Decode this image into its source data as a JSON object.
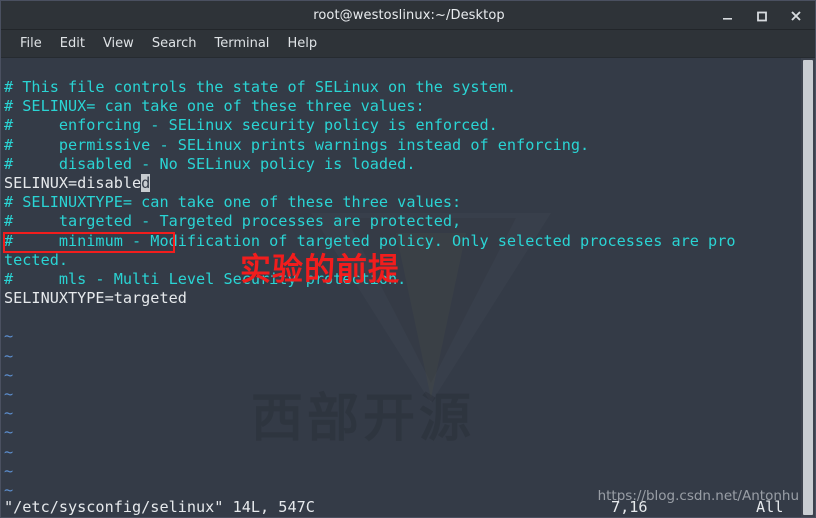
{
  "window": {
    "title": "root@westoslinux:~/Desktop",
    "controls": [
      {
        "name": "minimize",
        "glyph": "minimize-icon"
      },
      {
        "name": "maximize",
        "glyph": "maximize-icon"
      },
      {
        "name": "close",
        "glyph": "close-icon"
      }
    ]
  },
  "menubar": {
    "items": [
      "File",
      "Edit",
      "View",
      "Search",
      "Terminal",
      "Help"
    ]
  },
  "editor": {
    "lines": [
      {
        "text": "# This file controls the state of SELinux on the system.",
        "style": "comment"
      },
      {
        "text": "# SELINUX= can take one of these three values:",
        "style": "comment"
      },
      {
        "text": "#     enforcing - SELinux security policy is enforced.",
        "style": "comment"
      },
      {
        "text": "#     permissive - SELinux prints warnings instead of enforcing.",
        "style": "comment"
      },
      {
        "text": "#     disabled - No SELinux policy is loaded.",
        "style": "comment"
      },
      {
        "text": "SELINUX=disabled",
        "style": "plain",
        "cursor_col": 15
      },
      {
        "text": "# SELINUXTYPE= can take one of these three values:",
        "style": "comment"
      },
      {
        "text": "#     targeted - Targeted processes are protected,",
        "style": "comment"
      },
      {
        "text": "#     minimum - Modification of targeted policy. Only selected processes are pro",
        "style": "comment"
      },
      {
        "text": "tected.",
        "style": "comment"
      },
      {
        "text": "#     mls - Multi Level Security protection.",
        "style": "comment"
      },
      {
        "text": "SELINUXTYPE=targeted",
        "style": "plain"
      },
      {
        "text": "",
        "style": "plain"
      },
      {
        "text": "~",
        "style": "tilde"
      },
      {
        "text": "~",
        "style": "tilde"
      },
      {
        "text": "~",
        "style": "tilde"
      },
      {
        "text": "~",
        "style": "tilde"
      },
      {
        "text": "~",
        "style": "tilde"
      },
      {
        "text": "~",
        "style": "tilde"
      },
      {
        "text": "~",
        "style": "tilde"
      },
      {
        "text": "~",
        "style": "tilde"
      },
      {
        "text": "~",
        "style": "tilde"
      }
    ]
  },
  "status": {
    "file_info": "\"/etc/sysconfig/selinux\" 14L, 547C",
    "position": "7,16",
    "scroll_state": "All"
  },
  "annotations": {
    "red_note": "实验的前提",
    "red_note_color": "#f21d1d",
    "highlight_target": "SELINUX=disabled"
  },
  "watermarks": {
    "logo_text": "西部开源",
    "url_text": "https://blog.csdn.net/Antonhu"
  },
  "colors": {
    "titlebar_bg": "#2e3338",
    "menubar_bg": "#2e3338",
    "terminal_bg": "#343b47",
    "comment_fg": "#2ad4d4",
    "plain_fg": "#e6e9ec",
    "tilde_fg": "#5d8fd0",
    "accent_red": "#f21d1d",
    "scrollbar_thumb": "#c9cdd2"
  }
}
